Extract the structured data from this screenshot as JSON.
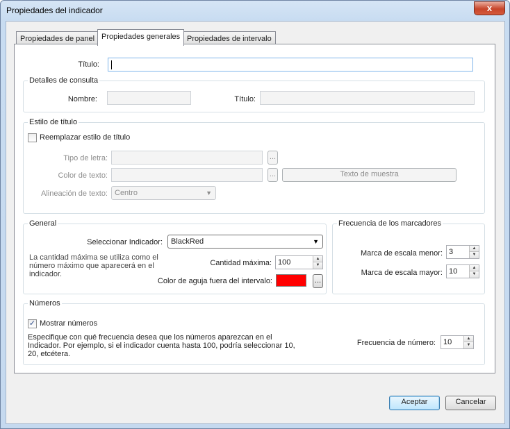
{
  "window": {
    "title": "Propiedades del indicador",
    "close_label": "x"
  },
  "tabs": [
    {
      "label": "Propiedades de panel",
      "active": false
    },
    {
      "label": "Propiedades generales",
      "active": true
    },
    {
      "label": "Propiedades de intervalo",
      "active": false
    }
  ],
  "title_row": {
    "label": "Título:",
    "value": ""
  },
  "query_details": {
    "legend": "Detalles de consulta",
    "name_label": "Nombre:",
    "name_value": "",
    "title_label": "Título:",
    "title_value": ""
  },
  "title_style": {
    "legend": "Estilo de título",
    "override_label": "Reemplazar estilo de título",
    "override_checked": false,
    "font_label": "Tipo de letra:",
    "font_value": "",
    "text_color_label": "Color de texto:",
    "text_color_value": "",
    "browse_label": "...",
    "sample_text_label": "Texto de muestra",
    "alignment_label": "Alineación de texto:",
    "alignment_value": "Centro"
  },
  "general": {
    "legend": "General",
    "select_label": "Seleccionar Indicador:",
    "select_value": "BlackRed",
    "description": "La cantidad máxima se utiliza como el número máximo que aparecerá en el indicador.",
    "max_label": "Cantidad máxima:",
    "max_value": "100",
    "needle_label": "Color de aguja fuera del intervalo:",
    "needle_color": "#ff0000",
    "browse_label": "..."
  },
  "marker_freq": {
    "legend": "Frecuencia de los marcadores",
    "minor_label": "Marca de escala menor:",
    "minor_value": "3",
    "major_label": "Marca de escala mayor:",
    "major_value": "10"
  },
  "numbers": {
    "legend": "Números",
    "show_label": "Mostrar números",
    "show_checked": true,
    "description": "Especifique con qué frecuencia desea que los números aparezcan en el Indicador. Por ejemplo, si el indicador cuenta hasta 100, podría seleccionar 10, 20, etcétera.",
    "freq_label": "Frecuencia de número:",
    "freq_value": "10"
  },
  "footer": {
    "accept_label": "Aceptar",
    "cancel_label": "Cancelar"
  }
}
